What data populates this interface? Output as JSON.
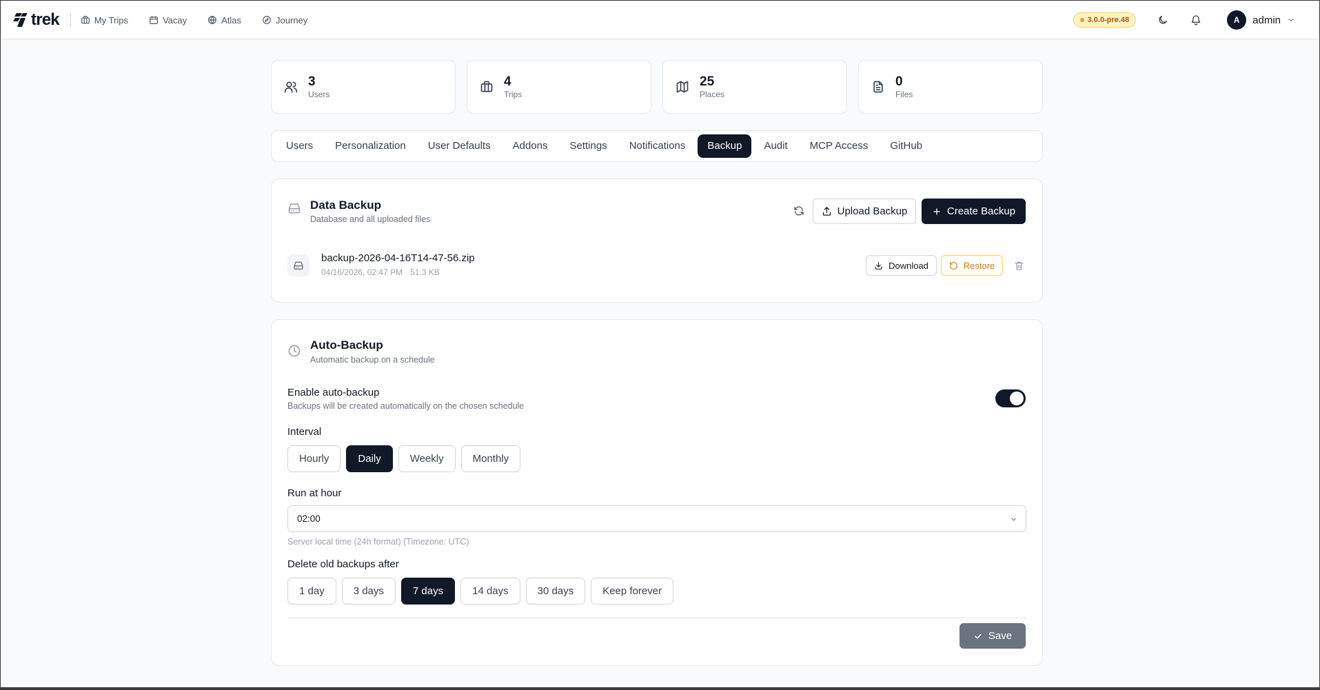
{
  "nav": {
    "brand": "trek",
    "links": [
      {
        "label": "My Trips",
        "icon": "briefcase-icon"
      },
      {
        "label": "Vacay",
        "icon": "calendar-icon"
      },
      {
        "label": "Atlas",
        "icon": "globe-icon"
      },
      {
        "label": "Journey",
        "icon": "compass-icon"
      }
    ],
    "version": "3.0.0-pre.48",
    "user": {
      "initial": "A",
      "name": "admin"
    }
  },
  "stats": [
    {
      "value": "3",
      "label": "Users",
      "icon": "users-icon"
    },
    {
      "value": "4",
      "label": "Trips",
      "icon": "briefcase-icon"
    },
    {
      "value": "25",
      "label": "Places",
      "icon": "map-icon"
    },
    {
      "value": "0",
      "label": "Files",
      "icon": "file-icon"
    }
  ],
  "tabs": [
    "Users",
    "Personalization",
    "User Defaults",
    "Addons",
    "Settings",
    "Notifications",
    "Backup",
    "Audit",
    "MCP Access",
    "GitHub"
  ],
  "active_tab": "Backup",
  "data_backup": {
    "title": "Data Backup",
    "subtitle": "Database and all uploaded files",
    "upload_label": "Upload Backup",
    "create_label": "Create Backup",
    "files": [
      {
        "name": "backup-2026-04-16T14-47-56.zip",
        "date": "04/16/2026, 02:47 PM",
        "size": "51.3 KB"
      }
    ],
    "download_label": "Download",
    "restore_label": "Restore"
  },
  "auto_backup": {
    "title": "Auto-Backup",
    "subtitle": "Automatic backup on a schedule",
    "enable_label": "Enable auto-backup",
    "enable_sub": "Backups will be created automatically on the chosen schedule",
    "enabled": true,
    "interval_label": "Interval",
    "intervals": [
      "Hourly",
      "Daily",
      "Weekly",
      "Monthly"
    ],
    "interval_selected": "Daily",
    "hour_label": "Run at hour",
    "hour_value": "02:00",
    "hour_hint": "Server local time (24h format) (Timezone: UTC)",
    "retention_label": "Delete old backups after",
    "retention_options": [
      "1 day",
      "3 days",
      "7 days",
      "14 days",
      "30 days",
      "Keep forever"
    ],
    "retention_selected": "7 days",
    "save_label": "Save"
  }
}
